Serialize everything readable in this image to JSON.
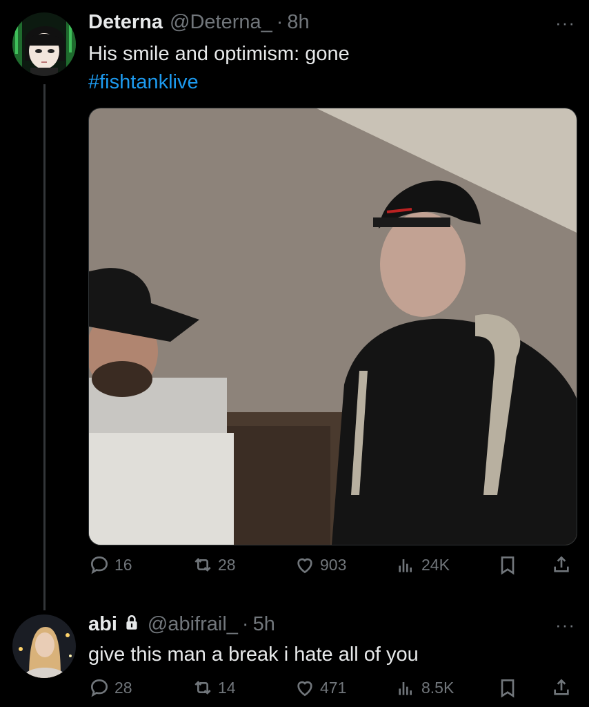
{
  "tweets": [
    {
      "name": "Deterna",
      "handle": "@Deterna_",
      "time": "8h",
      "text": "His smile and optimism: gone",
      "hashtag": "#fishtanklive",
      "replies": "16",
      "retweets": "28",
      "likes": "903",
      "views": "24K"
    },
    {
      "name": "abi",
      "handle": "@abifrail_",
      "time": "5h",
      "text": "give this man a break i hate all of you",
      "replies": "28",
      "retweets": "14",
      "likes": "471",
      "views": "8.5K"
    }
  ],
  "ui": {
    "more": "···",
    "dot": "·"
  },
  "colors": {
    "background": "#000000",
    "text": "#e7e9ea",
    "muted": "#71767b",
    "link": "#1d9bf0"
  },
  "icons": [
    "reply-icon",
    "retweet-icon",
    "like-icon",
    "views-icon",
    "bookmark-icon",
    "share-icon",
    "lock-icon",
    "more-icon"
  ]
}
